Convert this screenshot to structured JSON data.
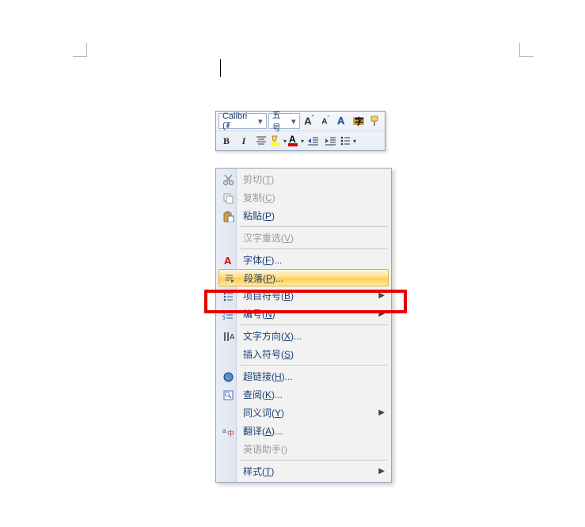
{
  "toolbar": {
    "font_name": "Calibri (₮",
    "font_size": "五号",
    "grow": "A",
    "shrink": "A",
    "bold": "B",
    "italic": "I"
  },
  "menu": {
    "items": [
      {
        "id": "cut",
        "label_pre": "剪切(",
        "hk": "T",
        "label_post": ")",
        "icon": "scissors",
        "disabled": true
      },
      {
        "id": "copy",
        "label_pre": "复制(",
        "hk": "C",
        "label_post": ")",
        "icon": "copy",
        "disabled": true
      },
      {
        "id": "paste",
        "label_pre": "粘贴(",
        "hk": "P",
        "label_post": ")",
        "icon": "paste"
      },
      {
        "sep": true
      },
      {
        "id": "reconvert",
        "label_pre": "汉字重选(",
        "hk": "V",
        "label_post": ")",
        "disabled": true
      },
      {
        "sep": true
      },
      {
        "id": "font",
        "label_pre": "字体(",
        "hk": "F",
        "label_post": ")...",
        "icon": "font-a"
      },
      {
        "id": "paragraph",
        "label_pre": "段落(",
        "hk": "P",
        "label_post": ")...",
        "icon": "paragraph",
        "highlight": true
      },
      {
        "id": "bullets",
        "label_pre": "项目符号(",
        "hk": "B",
        "label_post": ")",
        "icon": "bullets",
        "submenu": true
      },
      {
        "id": "numbering",
        "label_pre": "编号(",
        "hk": "N",
        "label_post": ")",
        "icon": "numbering",
        "submenu": true
      },
      {
        "sep": true
      },
      {
        "id": "direction",
        "label_pre": "文字方向(",
        "hk": "X",
        "label_post": ")...",
        "icon": "direction"
      },
      {
        "id": "symbol",
        "label_pre": "插入符号(",
        "hk": "S",
        "label_post": ")"
      },
      {
        "sep": true
      },
      {
        "id": "hyperlink",
        "label_pre": "超链接(",
        "hk": "H",
        "label_post": ")...",
        "icon": "globe"
      },
      {
        "id": "lookup",
        "label_pre": "查阅(",
        "hk": "K",
        "label_post": ")...",
        "icon": "lookup"
      },
      {
        "id": "synonym",
        "label_pre": "同义词(",
        "hk": "Y",
        "label_post": ")",
        "submenu": true
      },
      {
        "id": "translate",
        "label_pre": "翻译(",
        "hk": "A",
        "label_post": ")...",
        "icon": "translate"
      },
      {
        "id": "assistant",
        "label_pre": "英语助手(",
        "hk": "",
        "label_post": ")",
        "disabled": true
      },
      {
        "sep": true
      },
      {
        "id": "style",
        "label_pre": "样式(",
        "hk": "T",
        "label_post": ")",
        "submenu": true
      }
    ]
  }
}
